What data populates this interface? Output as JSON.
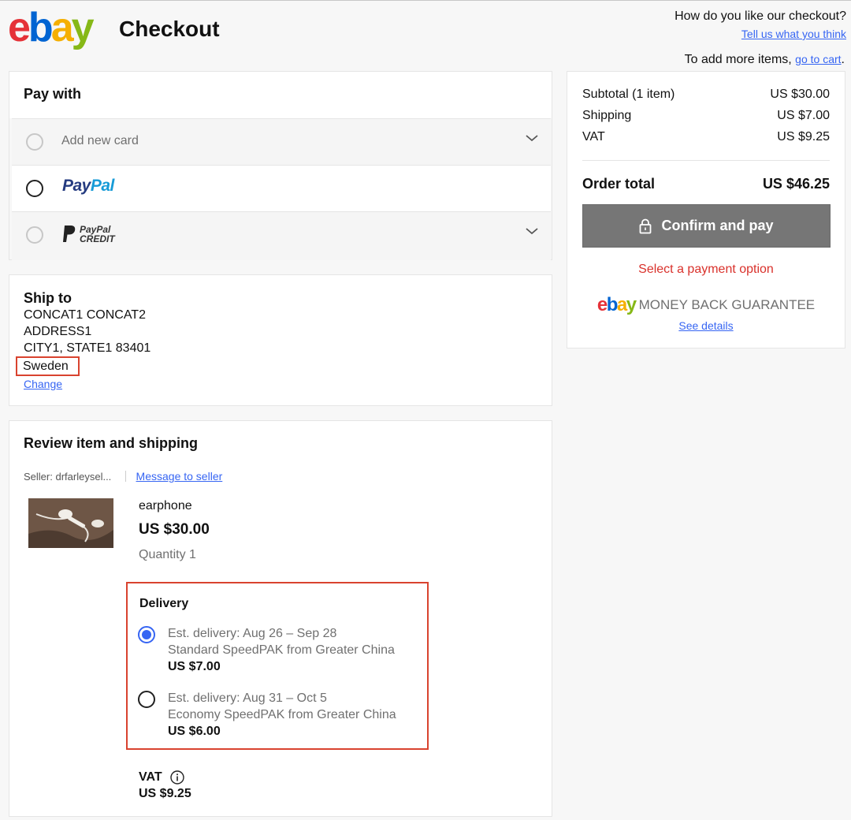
{
  "header": {
    "logo": {
      "e": "e",
      "b": "b",
      "a": "a",
      "y": "y"
    },
    "title": "Checkout",
    "feedback_question": "How do you like our checkout?",
    "feedback_link": "Tell us what you think",
    "add_items_text": "To add more items,",
    "add_items_link": "go to cart",
    "add_items_period": "."
  },
  "pay_with": {
    "title": "Pay with",
    "options": [
      {
        "label": "Add new card",
        "selected": false,
        "expandable": true
      },
      {
        "label": "PayPal",
        "logo_parts": [
          "Pay",
          "Pal"
        ],
        "selected": false,
        "expandable": false
      },
      {
        "label": "PayPal CREDIT",
        "logo_lines": [
          "PayPal",
          "CREDIT"
        ],
        "selected": false,
        "expandable": true
      }
    ]
  },
  "ship_to": {
    "title": "Ship to",
    "name": "CONCAT1 CONCAT2",
    "address": "ADDRESS1",
    "city_line": "CITY1, STATE1 83401",
    "country": "Sweden",
    "change_link": "Change"
  },
  "review": {
    "title": "Review item and shipping",
    "seller_label": "Seller:",
    "seller_name": "drfarleysel...",
    "message_link": "Message to seller",
    "item": {
      "name": "earphone",
      "price": "US $30.00",
      "quantity": "Quantity 1"
    },
    "delivery": {
      "title": "Delivery",
      "options": [
        {
          "est": "Est. delivery: Aug 26 – Sep 28",
          "service": "Standard SpeedPAK from Greater China",
          "price": "US $7.00",
          "selected": true
        },
        {
          "est": "Est. delivery: Aug 31 – Oct 5",
          "service": "Economy SpeedPAK from Greater China",
          "price": "US $6.00",
          "selected": false
        }
      ]
    },
    "vat_label": "VAT",
    "vat_value": "US $9.25"
  },
  "summary": {
    "subtotal_label": "Subtotal (1 item)",
    "subtotal_value": "US $30.00",
    "shipping_label": "Shipping",
    "shipping_value": "US $7.00",
    "vat_label": "VAT",
    "vat_value": "US $9.25",
    "total_label": "Order total",
    "total_value": "US $46.25",
    "confirm_button": "Confirm and pay",
    "select_message": "Select a payment option",
    "guarantee_text": "MONEY BACK GUARANTEE",
    "see_details": "See details"
  },
  "colors": {
    "link": "#3665f3",
    "error_red": "#d9312b",
    "highlight_box": "#d9432f",
    "disabled_button": "#767676",
    "logo_red": "#e53238",
    "logo_blue": "#0064d2",
    "logo_yellow": "#f5af02",
    "logo_green": "#86b817"
  },
  "icons": [
    "chevron-down-icon",
    "lock-icon",
    "info-icon",
    "paypal-credit-icon"
  ]
}
